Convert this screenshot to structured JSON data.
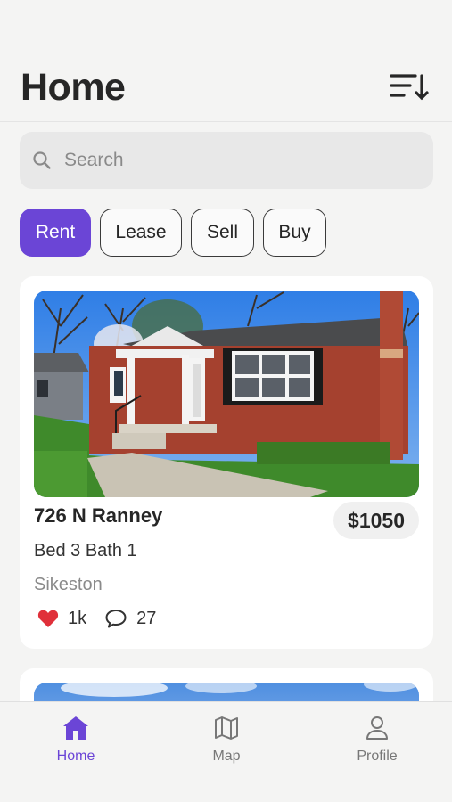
{
  "header": {
    "title": "Home"
  },
  "search": {
    "placeholder": "Search"
  },
  "filters": [
    {
      "label": "Rent",
      "active": true
    },
    {
      "label": "Lease",
      "active": false
    },
    {
      "label": "Sell",
      "active": false
    },
    {
      "label": "Buy",
      "active": false
    }
  ],
  "listings": [
    {
      "title": "726 N Ranney",
      "price": "$1050",
      "beds_baths": "Bed 3 Bath 1",
      "city": "Sikeston",
      "likes": "1k",
      "comments": "27"
    }
  ],
  "tabs": [
    {
      "label": "Home",
      "icon": "home-icon",
      "active": true
    },
    {
      "label": "Map",
      "icon": "map-icon",
      "active": false
    },
    {
      "label": "Profile",
      "icon": "profile-icon",
      "active": false
    }
  ],
  "colors": {
    "accent": "#6b45d6",
    "like": "#e0303a"
  }
}
